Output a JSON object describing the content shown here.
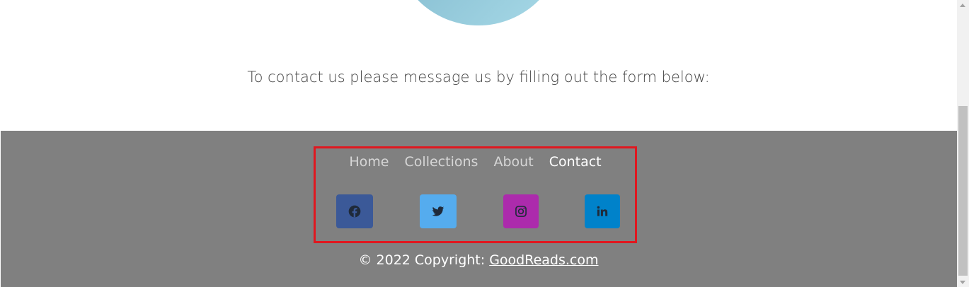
{
  "main": {
    "contact_text": "To contact us please message us by filling out the form below:"
  },
  "footer": {
    "nav": [
      {
        "label": "Home"
      },
      {
        "label": "Collections"
      },
      {
        "label": "About"
      },
      {
        "label": "Contact",
        "active": true
      }
    ],
    "social": [
      {
        "name": "facebook-icon",
        "color": "#3b5998"
      },
      {
        "name": "twitter-icon",
        "color": "#55acee"
      },
      {
        "name": "instagram-icon",
        "color": "#ac2bac"
      },
      {
        "name": "linkedin-icon",
        "color": "#0082ca"
      }
    ],
    "copyright_prefix": "© 2022 Copyright: ",
    "copyright_link": "GoodReads.com",
    "background": "#808080"
  },
  "annotation": {
    "highlight_color": "#e0171f"
  }
}
